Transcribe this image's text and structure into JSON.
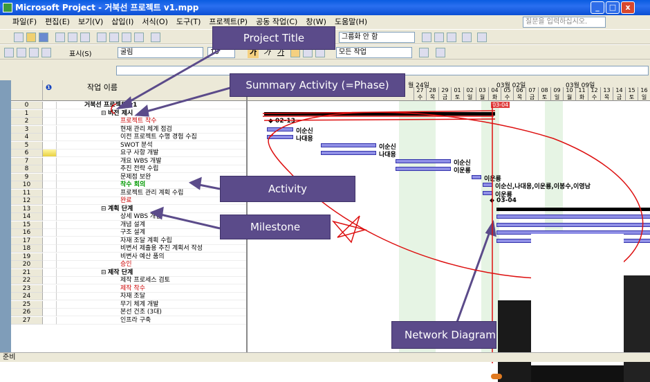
{
  "window": {
    "title": "Microsoft Project - 거북선 프로젝트 v1.mpp",
    "controls": [
      "_",
      "□",
      "x"
    ]
  },
  "menu": {
    "items": [
      "파일(F)",
      "편집(E)",
      "보기(V)",
      "삽입(I)",
      "서식(O)",
      "도구(T)",
      "프로젝트(P)",
      "공동 작업(C)",
      "창(W)",
      "도움말(H)"
    ],
    "help_placeholder": "질문을 입력하십시오."
  },
  "toolbar1": {
    "group_combo": "그룹화 안 함"
  },
  "toolbar2": {
    "show_label": "표시(S)",
    "font": "굴림",
    "size": "10",
    "bold": "가",
    "italic": "가",
    "underline": "가",
    "filter": "모든 작업"
  },
  "grid": {
    "header_info": "❶",
    "header_name": "작업 이름",
    "rows": [
      {
        "id": "0",
        "name": "거북선 프로젝트 v1",
        "level": 0,
        "color": "#000",
        "bold": true,
        "indicator": ""
      },
      {
        "id": "1",
        "name": "비전 제시",
        "level": 1,
        "color": "#000",
        "bold": true,
        "indicator": ""
      },
      {
        "id": "2",
        "name": "프로젝트 착수",
        "level": 2,
        "color": "#cc0000",
        "bold": false,
        "indicator": ""
      },
      {
        "id": "3",
        "name": "현재 관리 체계 점검",
        "level": 2,
        "color": "#000",
        "bold": false,
        "indicator": ""
      },
      {
        "id": "4",
        "name": "이전 프로젝트 수행 경험 수집",
        "level": 2,
        "color": "#000",
        "bold": false,
        "indicator": ""
      },
      {
        "id": "5",
        "name": "SWOT 분석",
        "level": 2,
        "color": "#000",
        "bold": false,
        "indicator": ""
      },
      {
        "id": "6",
        "name": "요구 사항 개발",
        "level": 2,
        "color": "#000",
        "bold": false,
        "indicator": "note"
      },
      {
        "id": "7",
        "name": "개요 WBS 개발",
        "level": 2,
        "color": "#000",
        "bold": false,
        "indicator": ""
      },
      {
        "id": "8",
        "name": "추진 전략 수립",
        "level": 2,
        "color": "#000",
        "bold": false,
        "indicator": ""
      },
      {
        "id": "9",
        "name": "문제점 보완",
        "level": 2,
        "color": "#000",
        "bold": false,
        "indicator": ""
      },
      {
        "id": "10",
        "name": "착수 회의",
        "level": 2,
        "color": "#009900",
        "bold": true,
        "indicator": ""
      },
      {
        "id": "11",
        "name": "프로젝트 관리 계획 수립",
        "level": 2,
        "color": "#000",
        "bold": false,
        "indicator": ""
      },
      {
        "id": "12",
        "name": "완료",
        "level": 2,
        "color": "#cc0000",
        "bold": false,
        "indicator": ""
      },
      {
        "id": "13",
        "name": "계획 단계",
        "level": 1,
        "color": "#000",
        "bold": true,
        "indicator": ""
      },
      {
        "id": "14",
        "name": "상세 WBS 개발",
        "level": 2,
        "color": "#000",
        "bold": false,
        "indicator": ""
      },
      {
        "id": "15",
        "name": "개념 설계",
        "level": 2,
        "color": "#000",
        "bold": false,
        "indicator": ""
      },
      {
        "id": "16",
        "name": "구조 설계",
        "level": 2,
        "color": "#000",
        "bold": false,
        "indicator": ""
      },
      {
        "id": "17",
        "name": "자재 조달 계획 수립",
        "level": 2,
        "color": "#000",
        "bold": false,
        "indicator": ""
      },
      {
        "id": "18",
        "name": "비변서 제출용 추진 계획서 작성",
        "level": 2,
        "color": "#000",
        "bold": false,
        "indicator": ""
      },
      {
        "id": "19",
        "name": "비변사 예산 품의",
        "level": 2,
        "color": "#000",
        "bold": false,
        "indicator": ""
      },
      {
        "id": "20",
        "name": "승인",
        "level": 2,
        "color": "#cc0000",
        "bold": false,
        "indicator": ""
      },
      {
        "id": "21",
        "name": "제작 단계",
        "level": 1,
        "color": "#000",
        "bold": true,
        "indicator": ""
      },
      {
        "id": "22",
        "name": "제작 프로세스 검토",
        "level": 2,
        "color": "#000",
        "bold": false,
        "indicator": ""
      },
      {
        "id": "23",
        "name": "제작 착수",
        "level": 2,
        "color": "#cc0000",
        "bold": false,
        "indicator": ""
      },
      {
        "id": "24",
        "name": "자재 조달",
        "level": 2,
        "color": "#000",
        "bold": false,
        "indicator": ""
      },
      {
        "id": "25",
        "name": "무기 체계 개발",
        "level": 2,
        "color": "#000",
        "bold": false,
        "indicator": ""
      },
      {
        "id": "26",
        "name": "본선 건조 (3대)",
        "level": 2,
        "color": "#000",
        "bold": false,
        "indicator": ""
      },
      {
        "id": "27",
        "name": "인프라 구축",
        "level": 2,
        "color": "#000",
        "bold": false,
        "indicator": ""
      }
    ]
  },
  "gantt": {
    "weeks": [
      "월 24일",
      "03월 02일",
      "03월 09일"
    ],
    "dates": [
      "27",
      "28",
      "29",
      "01",
      "02",
      "03",
      "04",
      "05",
      "06",
      "07",
      "08",
      "09",
      "10",
      "11",
      "12",
      "13",
      "14",
      "15",
      "16"
    ],
    "days": [
      "수",
      "목",
      "금",
      "토",
      "일",
      "월",
      "화",
      "수",
      "목",
      "금",
      "토",
      "일",
      "월",
      "화",
      "수",
      "목",
      "금",
      "토",
      "일"
    ],
    "today_flag": "03-04",
    "labels": {
      "m2": "02-13",
      "a3": "이순신",
      "a4": "나대용",
      "a5": "이순신",
      "a6": "나대용",
      "a7": "이순신",
      "a8": "이운룡",
      "a9": "이운룡",
      "a10": "이순신,나대용,이운룡,이봉수,이영남",
      "a11": "이운룡",
      "m12": "03-04"
    }
  },
  "callouts": {
    "title": "Project Title",
    "summary": "Summary Activity (=Phase)",
    "activity": "Activity",
    "milestone": "Milestone",
    "network": "Network Diagram"
  },
  "status": {
    "text": "준비"
  }
}
